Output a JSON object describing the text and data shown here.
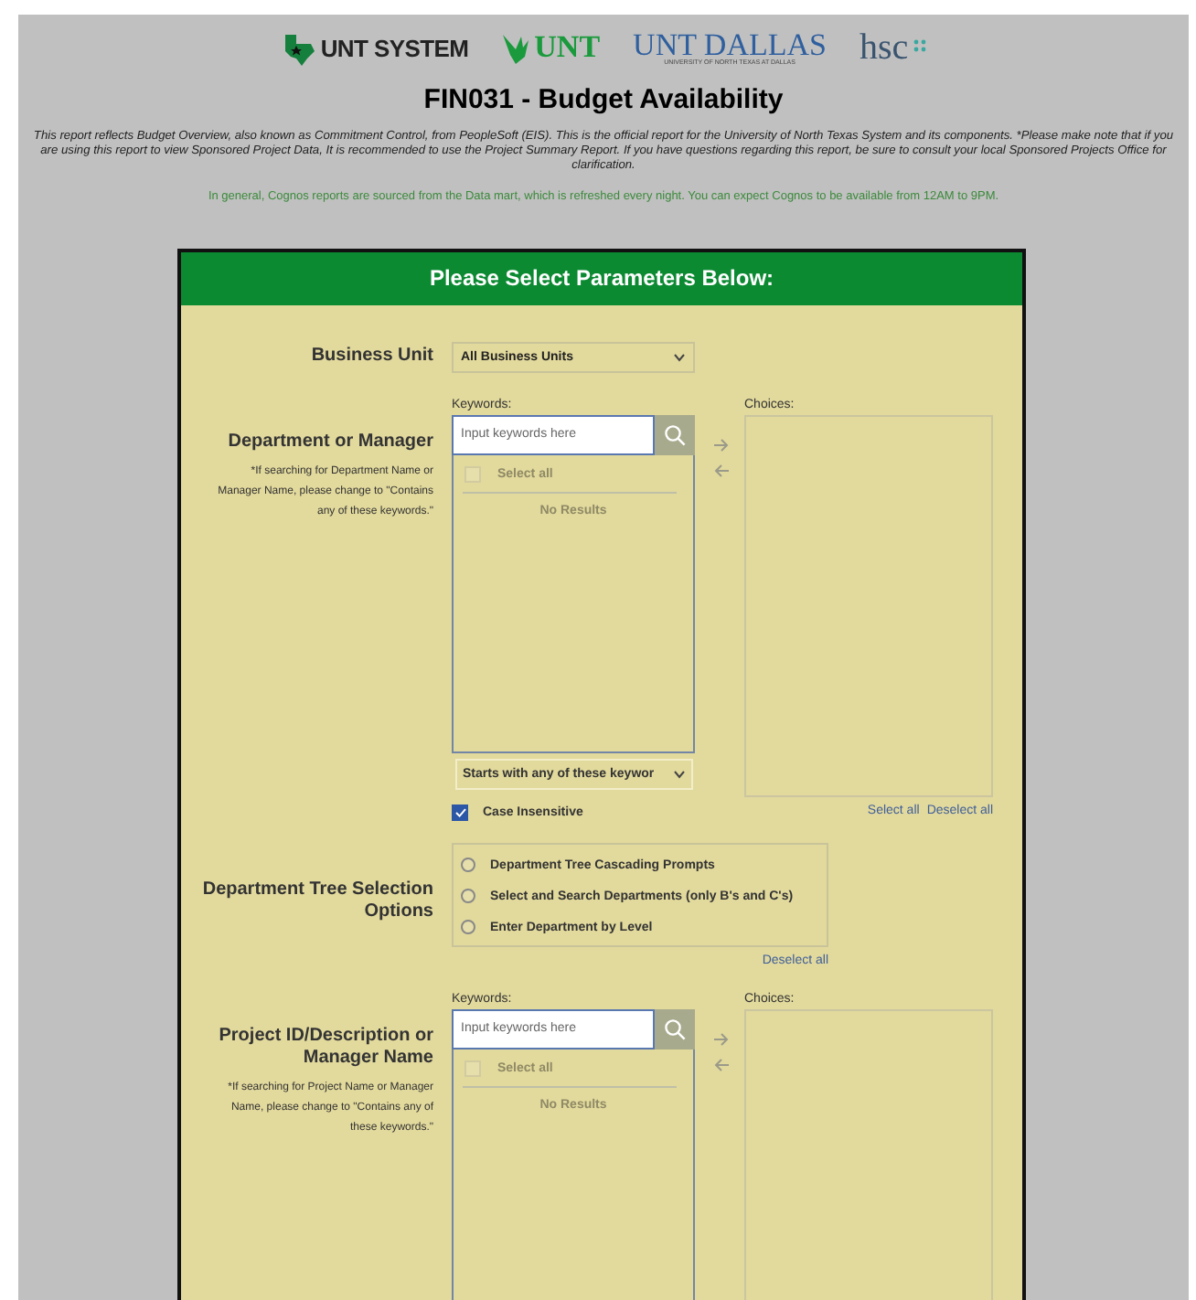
{
  "logos": [
    {
      "kind": "system",
      "text": "UNT SYSTEM"
    },
    {
      "kind": "unt",
      "text": "UNT"
    },
    {
      "kind": "dallas",
      "text": "UNT DALLAS",
      "subtext": "UNIVERSITY OF NORTH TEXAS AT DALLAS"
    },
    {
      "kind": "hsc",
      "text": "hsc"
    }
  ],
  "title": "FIN031 - Budget Availability",
  "notice": "This report reflects Budget Overview, also known as Commitment Control, from PeopleSoft (EIS). This is the official report for the University of North Texas System and its components. *Please make note that if you are using this report to view Sponsored Project Data, It is recommended to use the Project Summary Report. If you have questions regarding this report, be sure to consult your local Sponsored Projects Office for clarification.",
  "info": "In general, Cognos reports are sourced from the Data mart, which is refreshed every night. You can expect Cognos to be available from 12AM to 9PM.",
  "panel": {
    "header": "Please Select Parameters Below:",
    "sections": [
      {
        "kind": "select",
        "label": "Business Unit",
        "value": "All Business Units"
      },
      {
        "kind": "picker",
        "label": "Department or Manager",
        "note": "*If searching for Department Name or Manager Name, please change to \"Contains any of these keywords.\"",
        "keywords_label": "Keywords:",
        "placeholder": "Input keywords here",
        "select_all": "Select all",
        "select_all_checked": false,
        "empty": "No Results",
        "choices_label": "Choices:",
        "mode": "Starts with any of these keywor",
        "case_label": "Case Insensitive",
        "case_checked": true,
        "choices_select_all": "Select all",
        "choices_deselect_all": "Deselect all"
      },
      {
        "kind": "radio",
        "label": "Department Tree Selection Options",
        "options": [
          {
            "label": "Department Tree Cascading Prompts",
            "selected": false
          },
          {
            "label": "Select and Search Departments (only B's and C's)",
            "selected": false
          },
          {
            "label": "Enter Department by Level",
            "selected": false
          }
        ],
        "deselect_all": "Deselect all"
      },
      {
        "kind": "picker",
        "label": "Project ID/Description or Manager Name",
        "note": "*If searching for Project Name or Manager Name, please change to \"Contains any of these keywords.\"",
        "keywords_label": "Keywords:",
        "placeholder": "Input keywords here",
        "select_all": "Select all",
        "select_all_checked": false,
        "empty": "No Results",
        "choices_label": "Choices:"
      }
    ]
  }
}
